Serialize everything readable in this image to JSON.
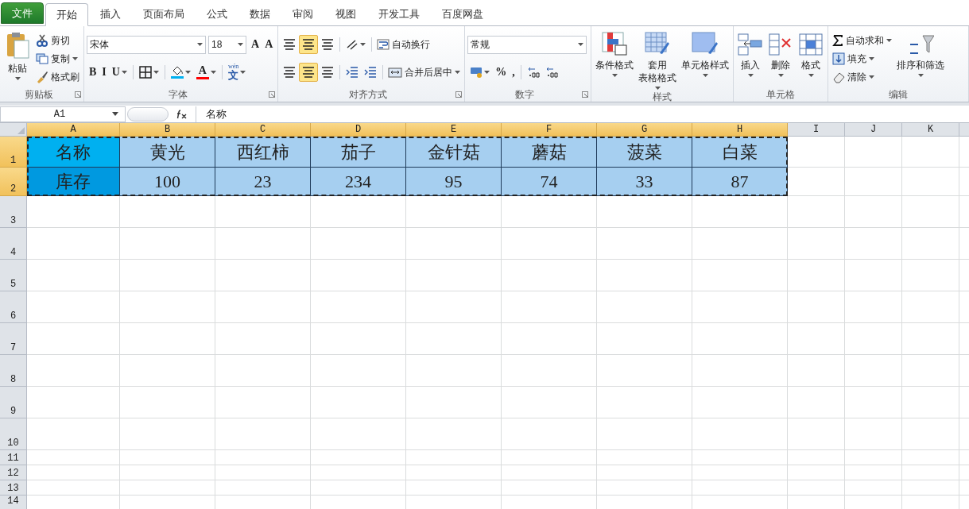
{
  "file_menu": "文件",
  "tabs": [
    {
      "label": "开始",
      "selected": true
    },
    {
      "label": "插入",
      "selected": false
    },
    {
      "label": "页面布局",
      "selected": false
    },
    {
      "label": "公式",
      "selected": false
    },
    {
      "label": "数据",
      "selected": false
    },
    {
      "label": "审阅",
      "selected": false
    },
    {
      "label": "视图",
      "selected": false
    },
    {
      "label": "开发工具",
      "selected": false
    },
    {
      "label": "百度网盘",
      "selected": false
    }
  ],
  "ribbon_groups": [
    {
      "label": "剪贴板",
      "launcher": true,
      "items": [
        {
          "kind": "large",
          "lines": [
            "粘贴"
          ],
          "dropdown": true
        },
        {
          "kind": "stack",
          "toolbars": [
            {
              "controls": [
                {
                  "kind": "small",
                  "label": "剪切",
                  "dropdown": false
                }
              ]
            },
            {
              "controls": [
                {
                  "kind": "small",
                  "label": "复制",
                  "dropdown": true
                }
              ]
            },
            {
              "controls": [
                {
                  "kind": "small",
                  "label": "格式刷",
                  "dropdown": false
                }
              ]
            }
          ]
        }
      ]
    },
    {
      "label": "字体",
      "launcher": true,
      "items": [
        {
          "kind": "stack",
          "toolbars": [
            {
              "controls": [
                {
                  "kind": "combo",
                  "value": "宋体"
                },
                {
                  "kind": "sizebox",
                  "value": "18"
                },
                {
                  "kind": "icon",
                  "glyph": "A",
                  "dropdown": false
                },
                {
                  "kind": "icon",
                  "glyph": "A",
                  "dropdown": false
                }
              ]
            },
            {
              "controls": [
                {
                  "kind": "icon",
                  "glyph": "B",
                  "dropdown": false
                },
                {
                  "kind": "icon",
                  "glyph": "I",
                  "dropdown": false
                },
                {
                  "kind": "icon",
                  "glyph": "U",
                  "dropdown": true
                },
                {
                  "kind": "sep"
                },
                {
                  "kind": "icon",
                  "dropdown": true
                },
                {
                  "kind": "sep"
                },
                {
                  "kind": "icon",
                  "color": "#00b0f0",
                  "dropdown": true
                },
                {
                  "kind": "icon",
                  "glyph": "A",
                  "color": "#ff0000",
                  "dropdown": true
                },
                {
                  "kind": "sep"
                },
                {
                  "kind": "icon",
                  "glyph": "文",
                  "note": "wén",
                  "dropdown": true
                }
              ]
            }
          ]
        }
      ]
    },
    {
      "label": "对齐方式",
      "launcher": true,
      "items": [
        {
          "kind": "stack",
          "toolbars": [
            {
              "controls": [
                {
                  "kind": "icon",
                  "selected": false,
                  "dropdown": false
                },
                {
                  "kind": "icon",
                  "selected": true,
                  "dropdown": false
                },
                {
                  "kind": "icon",
                  "selected": false,
                  "dropdown": false
                },
                {
                  "kind": "sep"
                },
                {
                  "kind": "icon",
                  "selected": false,
                  "dropdown": true
                },
                {
                  "kind": "sep"
                },
                {
                  "kind": "small",
                  "label": "自动换行",
                  "dropdown": false
                }
              ]
            },
            {
              "controls": [
                {
                  "kind": "icon",
                  "selected": false,
                  "dropdown": false
                },
                {
                  "kind": "icon",
                  "selected": true,
                  "dropdown": false
                },
                {
                  "kind": "icon",
                  "selected": false,
                  "dropdown": false
                },
                {
                  "kind": "sep"
                },
                {
                  "kind": "icon",
                  "selected": false,
                  "dropdown": false
                },
                {
                  "kind": "icon",
                  "selected": false,
                  "dropdown": false
                },
                {
                  "kind": "sep"
                },
                {
                  "kind": "small",
                  "label": "合并后居中",
                  "dropdown": true
                }
              ]
            }
          ]
        }
      ]
    },
    {
      "label": "数字",
      "launcher": true,
      "items": [
        {
          "kind": "stack",
          "toolbars": [
            {
              "controls": [
                {
                  "kind": "combo",
                  "value": "常规"
                }
              ]
            },
            {
              "controls": [
                {
                  "kind": "icon",
                  "dropdown": true
                },
                {
                  "kind": "icon",
                  "glyph": "%",
                  "dropdown": false
                },
                {
                  "kind": "icon",
                  "glyph": ",",
                  "dropdown": false
                },
                {
                  "kind": "sep"
                },
                {
                  "kind": "icon",
                  "dropdown": false
                },
                {
                  "kind": "icon",
                  "dropdown": false
                }
              ]
            }
          ]
        }
      ]
    },
    {
      "label": "样式",
      "launcher": false,
      "items": [
        {
          "kind": "large",
          "lines": [
            "条件格式"
          ],
          "dropdown": true
        },
        {
          "kind": "large",
          "lines": [
            "套用",
            "表格格式"
          ],
          "dropdown": true
        },
        {
          "kind": "large",
          "lines": [
            "单元格样式"
          ],
          "dropdown": true
        }
      ]
    },
    {
      "label": "单元格",
      "launcher": false,
      "items": [
        {
          "kind": "large",
          "lines": [
            "插入"
          ],
          "dropdown": true
        },
        {
          "kind": "large",
          "lines": [
            "删除"
          ],
          "dropdown": true
        },
        {
          "kind": "large",
          "lines": [
            "格式"
          ],
          "dropdown": true
        }
      ]
    },
    {
      "label": "编辑",
      "launcher": false,
      "items": [
        {
          "kind": "stack",
          "toolbars": [
            {
              "controls": [
                {
                  "kind": "small",
                  "label": "自动求和",
                  "dropdown": true
                }
              ]
            },
            {
              "controls": [
                {
                  "kind": "small",
                  "label": "填充",
                  "dropdown": true
                }
              ]
            },
            {
              "controls": [
                {
                  "kind": "small",
                  "label": "清除",
                  "dropdown": true
                }
              ]
            }
          ]
        },
        {
          "kind": "large",
          "lines": [
            "排序和筛选"
          ],
          "dropdown": true
        }
      ]
    }
  ],
  "name_box": "A1",
  "formula": "名称",
  "columns": [
    {
      "label": "A",
      "selected": true
    },
    {
      "label": "B",
      "selected": true
    },
    {
      "label": "C",
      "selected": true
    },
    {
      "label": "D",
      "selected": true
    },
    {
      "label": "E",
      "selected": true
    },
    {
      "label": "F",
      "selected": true
    },
    {
      "label": "G",
      "selected": true
    },
    {
      "label": "H",
      "selected": true
    },
    {
      "label": "I",
      "selected": false
    },
    {
      "label": "J",
      "selected": false
    },
    {
      "label": "K",
      "selected": false
    }
  ],
  "rows": [
    {
      "number": "1",
      "selected": true,
      "cells": [
        {
          "text": "名称",
          "color": "#00b0f0"
        },
        {
          "text": "黄光",
          "color": "#a6cff0"
        },
        {
          "text": "西红柿",
          "color": "#a6cff0"
        },
        {
          "text": "茄子",
          "color": "#a6cff0"
        },
        {
          "text": "金针菇",
          "color": "#a6cff0"
        },
        {
          "text": "蘑菇",
          "color": "#a6cff0"
        },
        {
          "text": "菠菜",
          "color": "#a6cff0"
        },
        {
          "text": "白菜",
          "color": "#a6cff0"
        }
      ]
    },
    {
      "number": "2",
      "selected": true,
      "cells": [
        {
          "text": "库存",
          "color": "#0099e0"
        },
        {
          "text": "100",
          "color": "#a6cff0"
        },
        {
          "text": "23",
          "color": "#a6cff0"
        },
        {
          "text": "234",
          "color": "#a6cff0"
        },
        {
          "text": "95",
          "color": "#a6cff0"
        },
        {
          "text": "74",
          "color": "#a6cff0"
        },
        {
          "text": "33",
          "color": "#a6cff0"
        },
        {
          "text": "87",
          "color": "#a6cff0"
        }
      ]
    },
    {
      "number": "3",
      "selected": false
    },
    {
      "number": "4",
      "selected": false
    },
    {
      "number": "5",
      "selected": false
    },
    {
      "number": "6",
      "selected": false
    },
    {
      "number": "7",
      "selected": false
    },
    {
      "number": "8",
      "selected": false
    },
    {
      "number": "9",
      "selected": false
    },
    {
      "number": "10",
      "selected": false
    },
    {
      "number": "11",
      "selected": false
    },
    {
      "number": "12",
      "selected": false
    },
    {
      "number": "13",
      "selected": false
    },
    {
      "number": "14",
      "selected": false
    }
  ]
}
